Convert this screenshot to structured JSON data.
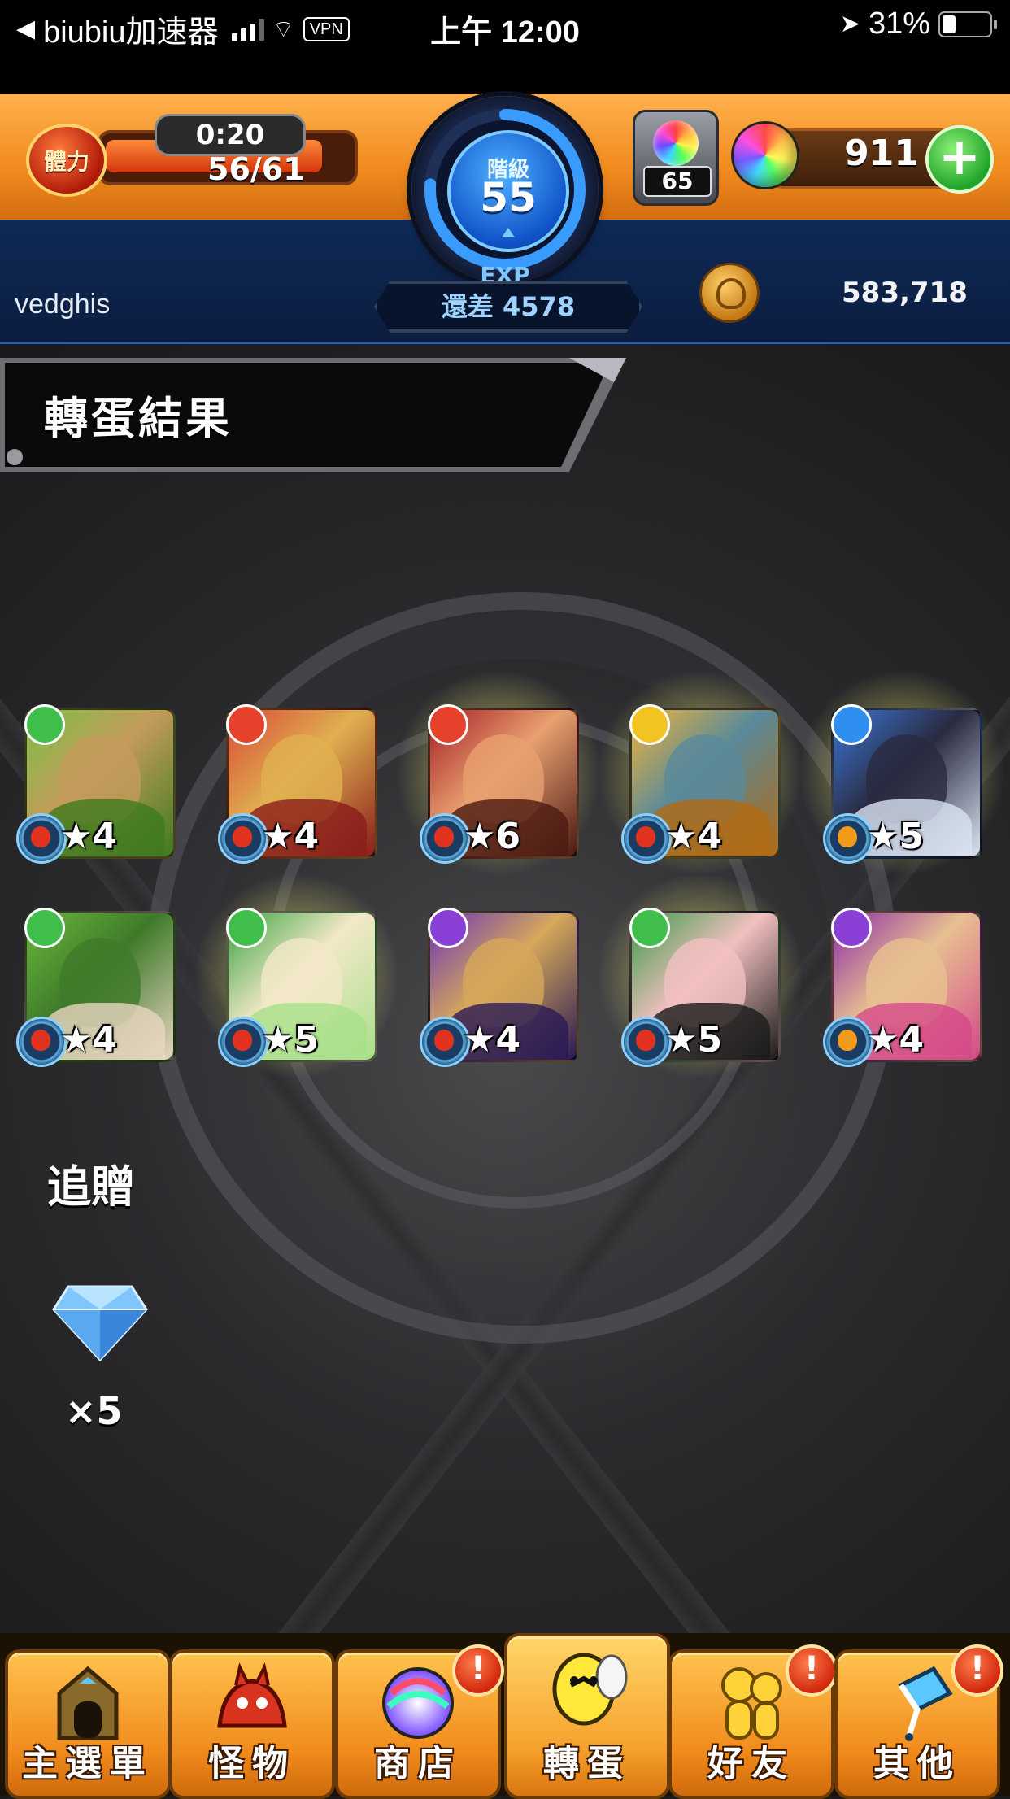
{
  "status_bar": {
    "carrier": "biubiu加速器",
    "vpn": "VPN",
    "time": "上午 12:00",
    "battery": "31%"
  },
  "hud": {
    "stamina_label": "體力",
    "stamina_timer": "0:20",
    "stamina_value": "56/61",
    "stamina_fraction": 0.918,
    "rank_label": "階級",
    "rank_value": "55",
    "exp_label": "EXP",
    "exp_remaining": "還差 4578",
    "orb_capacity": "65",
    "orb_count": "911",
    "username": "vedghis",
    "gold": "583,718"
  },
  "section_title": "轉蛋結果",
  "results": [
    {
      "stars": "★4",
      "attribute": "wood",
      "fruit": "red",
      "glow": false,
      "colors": [
        "#7cbf45",
        "#3d7a1e",
        "#c49b5a"
      ]
    },
    {
      "stars": "★4",
      "attribute": "fire",
      "fruit": "red",
      "glow": false,
      "colors": [
        "#d8493a",
        "#8a1d1a",
        "#e0b050"
      ]
    },
    {
      "stars": "★6",
      "attribute": "fire",
      "fruit": "red",
      "glow": true,
      "colors": [
        "#a51d25",
        "#4b1a12",
        "#e8a070"
      ]
    },
    {
      "stars": "★4",
      "attribute": "light",
      "fruit": "red",
      "glow": true,
      "colors": [
        "#f0b33a",
        "#b36a12",
        "#5a8a9a"
      ]
    },
    {
      "stars": "★5",
      "attribute": "water",
      "fruit": "orange",
      "glow": true,
      "colors": [
        "#3a78d8",
        "#d9e4f2",
        "#2a2a40"
      ]
    },
    {
      "stars": "★4",
      "attribute": "wood",
      "fruit": "red",
      "glow": false,
      "colors": [
        "#6ab83a",
        "#e8d6c0",
        "#3e7a2a"
      ]
    },
    {
      "stars": "★5",
      "attribute": "wood",
      "fruit": "red",
      "glow": true,
      "colors": [
        "#3aa340",
        "#a8e08a",
        "#f3e8c8"
      ]
    },
    {
      "stars": "★4",
      "attribute": "dark",
      "fruit": "red",
      "glow": false,
      "colors": [
        "#6a34b8",
        "#2a1a55",
        "#d6a85a"
      ]
    },
    {
      "stars": "★5",
      "attribute": "wood",
      "fruit": "red",
      "glow": true,
      "colors": [
        "#3a9a48",
        "#1a1a1a",
        "#f2c0c0"
      ]
    },
    {
      "stars": "★4",
      "attribute": "dark",
      "fruit": "orange",
      "glow": false,
      "colors": [
        "#8a2aa8",
        "#d44a8a",
        "#e8c090"
      ]
    }
  ],
  "attribute_colors": {
    "wood": "#3fbf4a",
    "fire": "#e5412b",
    "light": "#f3c322",
    "water": "#2e8ff0",
    "dark": "#8a3fd6"
  },
  "fruit_colors": {
    "red": "#e0321e",
    "orange": "#f29a1b"
  },
  "bonus": {
    "label": "追贈",
    "item": "gem-icon",
    "count": "×5"
  },
  "nav": [
    {
      "label": "主選單",
      "icon": "gate-icon",
      "alert": false,
      "active": false
    },
    {
      "label": "怪物",
      "icon": "monster-icon",
      "alert": false,
      "active": false
    },
    {
      "label": "商店",
      "icon": "orb-icon",
      "alert": true,
      "active": false
    },
    {
      "label": "轉蛋",
      "icon": "egg-icon",
      "alert": false,
      "active": true
    },
    {
      "label": "好友",
      "icon": "friends-icon",
      "alert": true,
      "active": false
    },
    {
      "label": "其他",
      "icon": "other-icon",
      "alert": true,
      "active": false
    }
  ],
  "alert_mark": "!"
}
